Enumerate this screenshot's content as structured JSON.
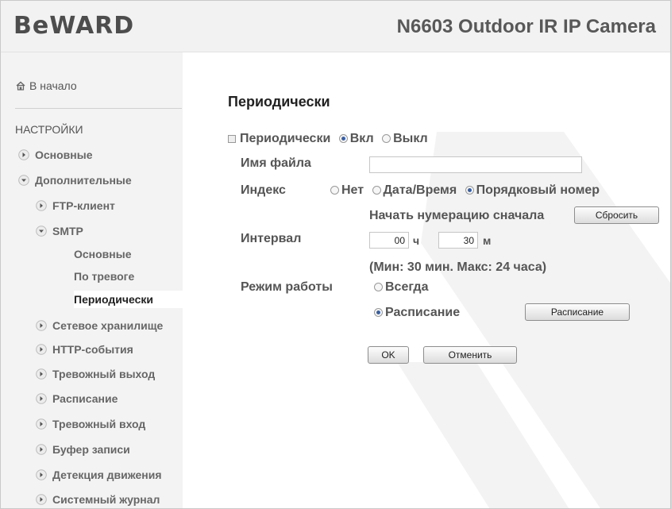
{
  "header": {
    "logo": "BeWARD",
    "model": "N6603 Outdoor IR IP Camera"
  },
  "sidebar": {
    "home": "В начало",
    "section_title": "НАСТРОЙКИ",
    "items": [
      {
        "label": "Основные",
        "state": "collapsed"
      },
      {
        "label": "Дополнительные",
        "state": "expanded"
      },
      {
        "label": "FTP-клиент",
        "state": "collapsed"
      },
      {
        "label": "SMTP",
        "state": "expanded"
      },
      {
        "label": "Сетевое хранилище",
        "state": "collapsed"
      },
      {
        "label": "HTTP-события",
        "state": "collapsed"
      },
      {
        "label": "Тревожный выход",
        "state": "collapsed"
      },
      {
        "label": "Расписание",
        "state": "collapsed"
      },
      {
        "label": "Тревожный вход",
        "state": "collapsed"
      },
      {
        "label": "Буфер записи",
        "state": "collapsed"
      },
      {
        "label": "Детекция движения",
        "state": "collapsed"
      },
      {
        "label": "Системный журнал",
        "state": "collapsed"
      }
    ],
    "smtp_sub": [
      {
        "label": "Основные"
      },
      {
        "label": "По тревоге"
      },
      {
        "label": "Периодически",
        "active": true
      }
    ]
  },
  "form": {
    "title": "Периодически",
    "enable_label": "Периодически",
    "on_label": "Вкл",
    "off_label": "Выкл",
    "enabled": true,
    "filename_label": "Имя файла",
    "filename_value": "",
    "index_label": "Индекс",
    "index_none": "Нет",
    "index_datetime": "Дата/Время",
    "index_serial": "Порядковый номер",
    "index_selected": "serial",
    "restart_label": "Начать нумерацию сначала",
    "reset_button": "Сбросить",
    "interval_label": "Интервал",
    "interval_hours": "00",
    "hours_unit": "ч",
    "interval_minutes": "30",
    "minutes_unit": "м",
    "interval_hint": "(Мин: 30 мин. Макс: 24 часа)",
    "mode_label": "Режим работы",
    "mode_always": "Всегда",
    "mode_schedule": "Расписание",
    "mode_selected": "schedule",
    "schedule_button": "Расписание",
    "ok_button": "OK",
    "cancel_button": "Отменить"
  },
  "colors": {
    "header_bg": "#f2f2f2",
    "sidebar_bg": "#f3f3f3",
    "radio_dot": "#3a5fa0"
  }
}
